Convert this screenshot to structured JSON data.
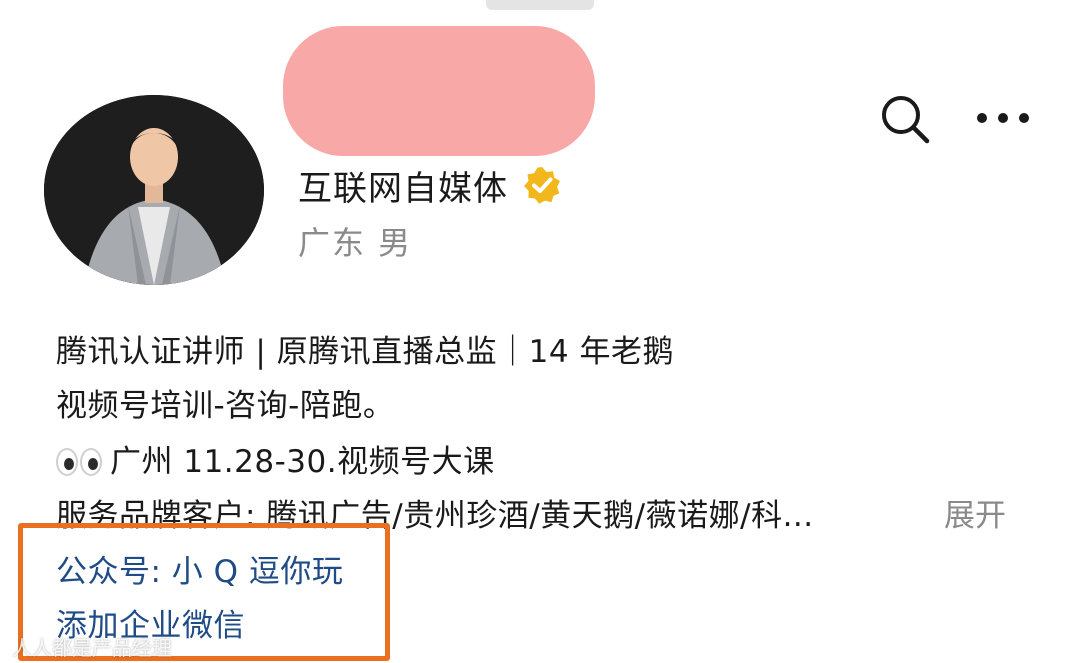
{
  "profile": {
    "account_type": "互联网自媒体",
    "location": "广东 男",
    "verified": true,
    "verified_color": "#f2b71b",
    "name_redaction_color": "#f8a8a6"
  },
  "actions": {
    "search_icon": "search-icon",
    "more_icon": "more-dots-icon"
  },
  "bio": {
    "line1": "腾讯认证讲师 | 原腾讯直播总监｜14 年老鹅",
    "line2": "视频号培训-咨询-陪跑。",
    "line3_emoji": "eyes-emoji",
    "line3": "广州 11.28-30.视频号大课",
    "line4": "服务品牌客户: 腾讯广告/贵州珍酒/黄天鹅/薇诺娜/科...",
    "expand_label": "展开"
  },
  "links": {
    "official_account": "公众号: 小 Q 逗你玩",
    "add_wechat": "添加企业微信",
    "link_color": "#1f4b86"
  },
  "annotation": {
    "highlight_color": "#ea6f20"
  },
  "watermark": {
    "text": "人人都是产品经理"
  }
}
